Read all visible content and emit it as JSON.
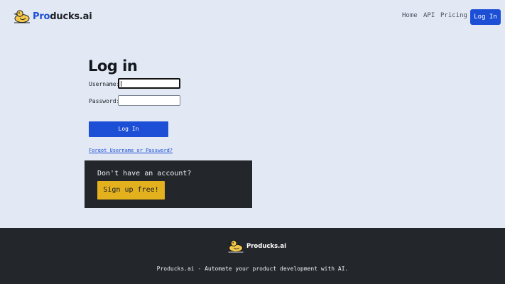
{
  "brand": {
    "name_prefix": "Pro",
    "name_rest": "ducks.ai"
  },
  "nav": {
    "home": "Home",
    "api": "API",
    "pricing": "Pricing",
    "login": "Log In"
  },
  "login": {
    "title": "Log in",
    "username_label": "Username:",
    "username_value": "",
    "password_label": "Password:",
    "password_value": "",
    "submit_label": "Log In",
    "forgot_link": "Forgot Username or Password?"
  },
  "signup": {
    "prompt": "Don't have an account?",
    "button_label": "Sign up free!"
  },
  "footer": {
    "brand": "Producks.ai",
    "tagline": "Producks.ai - Automate your product development with AI."
  },
  "colors": {
    "page_background": "#e2e9f4",
    "accent_blue": "#1d4fd6",
    "dark_panel": "#23262b",
    "signup_yellow": "#e4b11e",
    "duck_yellow": "#f2c94c"
  },
  "icons": {
    "logo": "duck-logo-icon",
    "footer_logo": "duck-logo-icon"
  }
}
